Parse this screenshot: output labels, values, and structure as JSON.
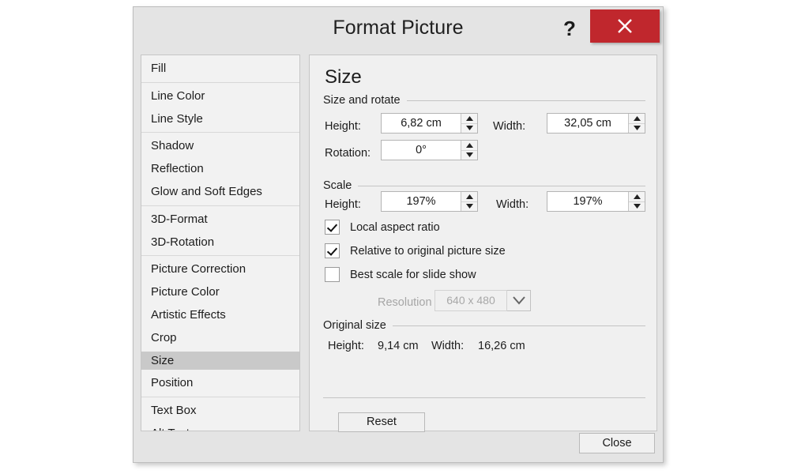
{
  "window": {
    "title": "Format Picture",
    "help_icon": "?",
    "close_icon": "close-x"
  },
  "sidebar": {
    "groups": [
      {
        "items": [
          {
            "label": "Fill",
            "selected": false
          }
        ]
      },
      {
        "items": [
          {
            "label": "Line Color",
            "selected": false
          },
          {
            "label": "Line Style",
            "selected": false
          }
        ]
      },
      {
        "items": [
          {
            "label": "Shadow",
            "selected": false
          },
          {
            "label": "Reflection",
            "selected": false
          },
          {
            "label": "Glow and Soft Edges",
            "selected": false
          }
        ]
      },
      {
        "items": [
          {
            "label": "3D-Format",
            "selected": false
          },
          {
            "label": "3D-Rotation",
            "selected": false
          }
        ]
      },
      {
        "items": [
          {
            "label": "Picture Correction",
            "selected": false
          },
          {
            "label": "Picture Color",
            "selected": false
          },
          {
            "label": "Artistic Effects",
            "selected": false
          },
          {
            "label": "Crop",
            "selected": false
          },
          {
            "label": "Size",
            "selected": true
          },
          {
            "label": "Position",
            "selected": false
          }
        ]
      },
      {
        "items": [
          {
            "label": "Text Box",
            "selected": false
          },
          {
            "label": "Alt Text",
            "selected": false
          }
        ]
      }
    ]
  },
  "panel": {
    "title": "Size",
    "size_and_rotate": {
      "legend": "Size and rotate",
      "height_label": "Height:",
      "height_value": "6,82 cm",
      "width_label": "Width:",
      "width_value": "32,05 cm",
      "rotation_label": "Rotation:",
      "rotation_value": "0°"
    },
    "scale": {
      "legend": "Scale",
      "height_label": "Height:",
      "height_value": "197%",
      "width_label": "Width:",
      "width_value": "197%",
      "checkboxes": [
        {
          "label": "Local aspect ratio",
          "checked": true
        },
        {
          "label": "Relative to original picture size",
          "checked": true
        },
        {
          "label": "Best scale for slide show",
          "checked": false
        }
      ],
      "resolution_label": "Resolution",
      "resolution_value": "640 x 480",
      "resolution_enabled": false
    },
    "original_size": {
      "legend": "Original size",
      "height_label": "Height:",
      "height_value": "9,14 cm",
      "width_label": "Width:",
      "width_value": "16,26 cm"
    },
    "reset_label": "Reset"
  },
  "footer": {
    "close_label": "Close"
  },
  "colors": {
    "close_button": "#c0272d",
    "dialog_bg": "#e4e4e4",
    "panel_bg": "#f0f0f0",
    "sidebar_bg": "#f2f2f2",
    "selected_item": "#c9c9c9"
  }
}
